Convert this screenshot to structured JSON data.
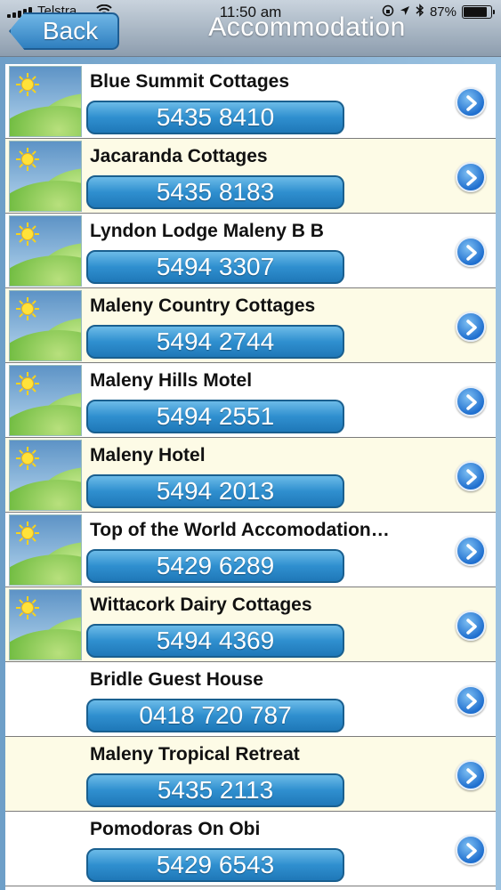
{
  "status_bar": {
    "carrier": "Telstra",
    "time": "11:50 am",
    "battery": "87%",
    "battery_level": 0.87
  },
  "nav": {
    "back_label": "Back",
    "title": "Accommodation"
  },
  "items": [
    {
      "name": "Blue Summit Cottages",
      "phone": "5435 8410",
      "has_image": true
    },
    {
      "name": "Jacaranda Cottages",
      "phone": "5435 8183",
      "has_image": true
    },
    {
      "name": "Lyndon Lodge Maleny B  B",
      "phone": "5494 3307",
      "has_image": true
    },
    {
      "name": "Maleny Country Cottages",
      "phone": "5494 2744",
      "has_image": true
    },
    {
      "name": "Maleny Hills Motel",
      "phone": "5494 2551",
      "has_image": true
    },
    {
      "name": "Maleny Hotel",
      "phone": "5494 2013",
      "has_image": true
    },
    {
      "name": "Top of the World Accomodation…",
      "phone": "5429 6289",
      "has_image": true
    },
    {
      "name": "Wittacork Dairy Cottages",
      "phone": "5494 4369",
      "has_image": true
    },
    {
      "name": "Bridle Guest House",
      "phone": "0418 720 787",
      "has_image": false
    },
    {
      "name": "Maleny Tropical Retreat",
      "phone": "5435 2113",
      "has_image": false
    },
    {
      "name": "Pomodoras On Obi",
      "phone": "5429 6543",
      "has_image": false
    }
  ],
  "icons": {
    "thumbnail": "landscape-placeholder-icon",
    "detail": "chevron-right-circle-icon"
  },
  "colors": {
    "phone_button": "#2f8fcf",
    "alt_row": "#fdfbe6",
    "nav_bar": "#aebbc8"
  }
}
